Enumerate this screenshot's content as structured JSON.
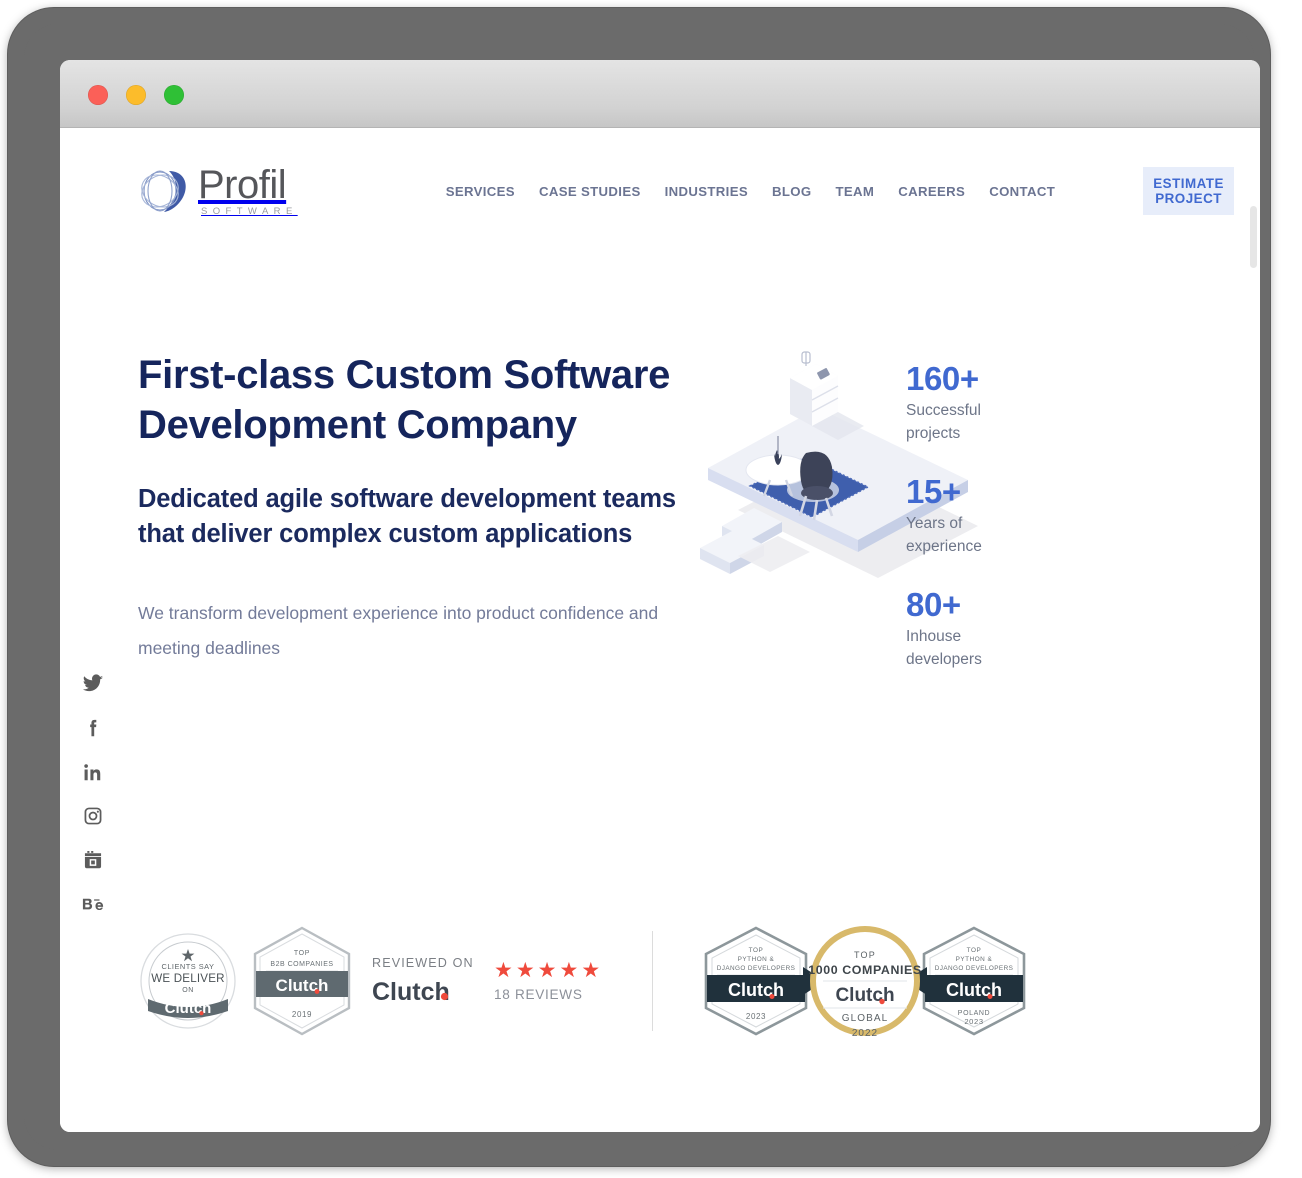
{
  "browser": {
    "traffic_lights": [
      "close",
      "minimize",
      "zoom"
    ],
    "colors": {
      "close": "#fb6058",
      "minimize": "#fcbc2b",
      "zoom": "#2fc036"
    }
  },
  "header": {
    "logo": {
      "word": "Profil",
      "sub": "SOFTWARE"
    },
    "nav": [
      {
        "label": "SERVICES"
      },
      {
        "label": "CASE STUDIES"
      },
      {
        "label": "INDUSTRIES"
      },
      {
        "label": "BLOG"
      },
      {
        "label": "TEAM"
      },
      {
        "label": "CAREERS"
      },
      {
        "label": "CONTACT"
      }
    ],
    "cta": {
      "label": "ESTIMATE PROJECT",
      "bg": "#e7edfa",
      "color": "#4069d0"
    }
  },
  "social": [
    {
      "name": "twitter"
    },
    {
      "name": "facebook"
    },
    {
      "name": "linkedin"
    },
    {
      "name": "instagram"
    },
    {
      "name": "youtube"
    },
    {
      "name": "behance"
    }
  ],
  "hero": {
    "title": "First-class Custom Software Development Company",
    "subtitle": "Dedicated agile software development teams that deliver complex custom applications",
    "description": "We transform development experience into product confidence and meeting deadlines",
    "title_color": "#15255c",
    "accent_color": "#4069d0"
  },
  "stats": [
    {
      "value": "160+",
      "label": "Successful projects"
    },
    {
      "value": "15+",
      "label": "Years of experience"
    },
    {
      "value": "80+",
      "label": "Inhouse developers"
    }
  ],
  "badges": {
    "left": [
      {
        "type": "circle",
        "line1": "CLIENTS SAY",
        "line2": "WE DELIVER",
        "line3": "ON",
        "brand": "Clutch"
      },
      {
        "type": "hexagon",
        "line1": "TOP",
        "line2": "B2B COMPANIES",
        "brand": "Clutch",
        "year": "2019"
      }
    ],
    "reviewed": {
      "prefix": "REVIEWED ON",
      "brand": "Clutch",
      "stars": 5,
      "star_color": "#ef4a3c",
      "count": "18 REVIEWS"
    },
    "right": [
      {
        "type": "hexagon",
        "line1": "TOP",
        "line2": "PYTHON &",
        "line3": "DJANGO DEVELOPERS",
        "brand": "Clutch",
        "year": "2023"
      },
      {
        "type": "circle-gold",
        "line1": "TOP",
        "line2": "1000 COMPANIES",
        "brand": "Clutch",
        "line3": "GLOBAL",
        "year": "2022"
      },
      {
        "type": "hexagon",
        "line1": "TOP",
        "line2": "PYTHON &",
        "line3": "DJANGO DEVELOPERS",
        "brand": "Clutch",
        "region": "POLAND",
        "year": "2023"
      }
    ]
  }
}
